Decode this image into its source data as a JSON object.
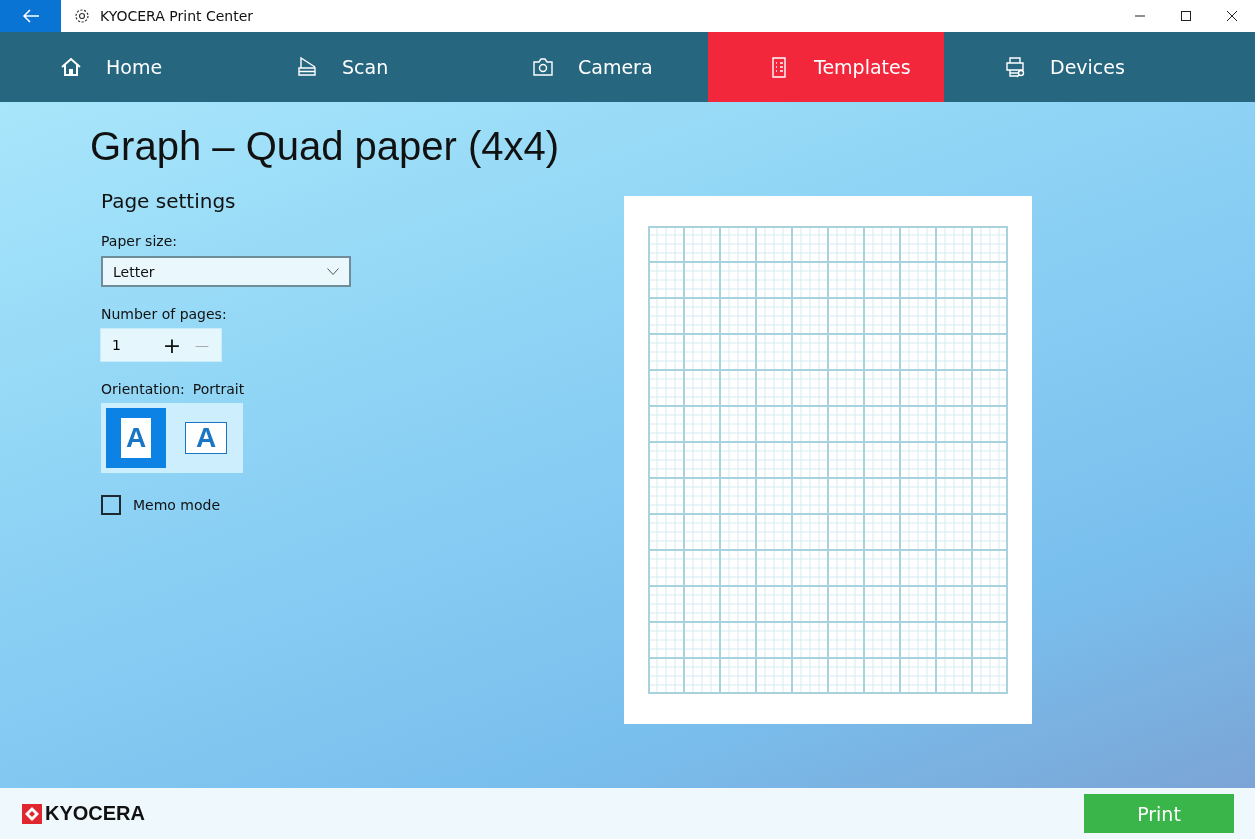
{
  "window": {
    "title": "KYOCERA Print Center"
  },
  "nav": [
    {
      "label": "Home",
      "kind": "home",
      "selected": false
    },
    {
      "label": "Scan",
      "kind": "scan",
      "selected": false
    },
    {
      "label": "Camera",
      "kind": "camera",
      "selected": false
    },
    {
      "label": "Templates",
      "kind": "template",
      "selected": true
    },
    {
      "label": "Devices",
      "kind": "devices",
      "selected": false
    }
  ],
  "page_title": "Graph – Quad paper (4x4)",
  "settings": {
    "heading": "Page settings",
    "paper_size": {
      "label": "Paper size:",
      "value": "Letter"
    },
    "pages": {
      "label": "Number of pages:",
      "value": "1",
      "plus": "+",
      "minus": "—"
    },
    "orientation": {
      "label": "Orientation:",
      "value": "Portrait",
      "options": [
        {
          "kind": "portrait",
          "glyph": "A",
          "selected": true
        },
        {
          "kind": "landscape",
          "glyph": "A",
          "selected": false
        }
      ]
    },
    "memo_mode": {
      "label": "Memo mode",
      "checked": false
    }
  },
  "footer": {
    "logo": "KYOCERA",
    "print_button": "Print"
  }
}
